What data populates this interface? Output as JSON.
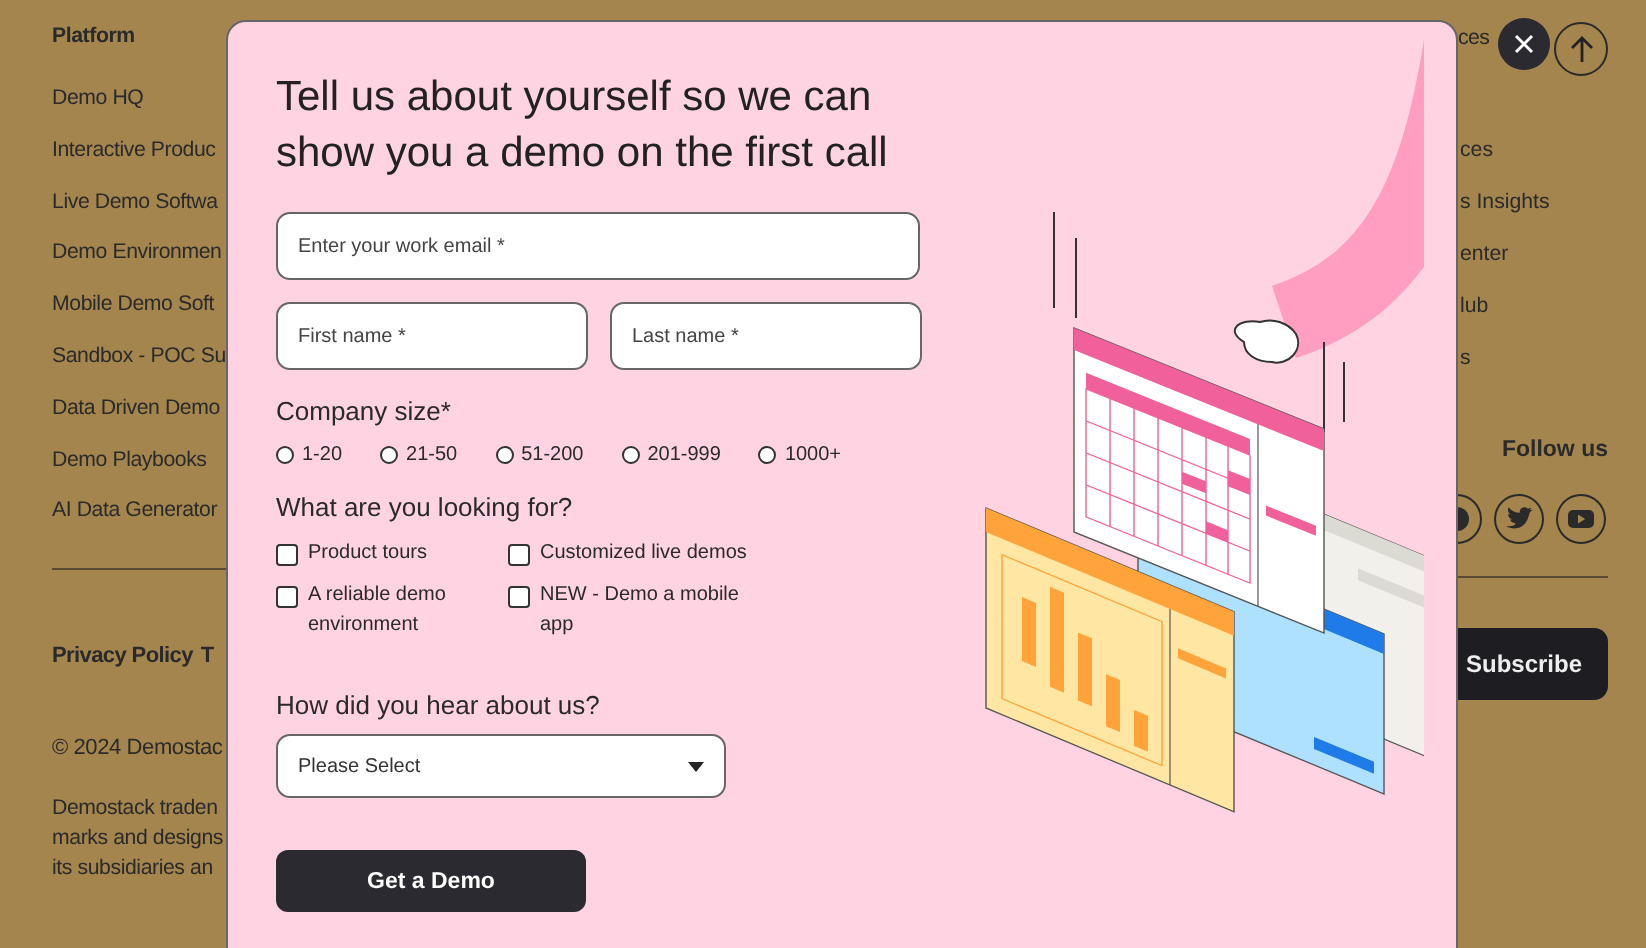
{
  "footer": {
    "left": {
      "heading": "Platform",
      "links": [
        "Demo HQ",
        "Interactive Produc",
        "Live Demo Softwa",
        "Demo Environmen",
        "Mobile Demo Soft",
        "Sandbox - POC Su",
        "Data Driven Demo",
        "Demo Playbooks",
        "AI Data Generator"
      ],
      "legal_links": [
        "Privacy Policy",
        "T"
      ],
      "copyright": "© 2024 Demostac",
      "trademark_lines": [
        "Demostack traden",
        "marks and designs",
        "its subsidiaries an"
      ]
    },
    "right": {
      "heading": "ces",
      "links": [
        "ces",
        "s Insights",
        "enter",
        "lub",
        "s"
      ],
      "follow_label": "Follow us",
      "subscribe_button": "Subscribe"
    }
  },
  "modal": {
    "title": "Tell us about yourself so we can show you a demo on the first call",
    "email": {
      "placeholder": "Enter your work email *"
    },
    "first_name": {
      "placeholder": "First name *"
    },
    "last_name": {
      "placeholder": "Last name *"
    },
    "company_size": {
      "label": "Company size*",
      "options": [
        {
          "label": "1-20",
          "selected": false
        },
        {
          "label": "21-50",
          "selected": false
        },
        {
          "label": "51-200",
          "selected": false
        },
        {
          "label": "201-999",
          "selected": false
        },
        {
          "label": "1000+",
          "selected": false
        }
      ]
    },
    "looking_for": {
      "label": "What are you looking for?",
      "options": [
        {
          "label": "Product tours",
          "checked": false
        },
        {
          "label": "Customized live demos",
          "checked": false
        },
        {
          "label": "A reliable demo environment",
          "checked": false
        },
        {
          "label": "NEW - Demo a mobile app",
          "checked": false
        }
      ]
    },
    "source": {
      "label": "How did you hear about us?",
      "value": "Please Select"
    },
    "submit_button": "Get a Demo"
  }
}
